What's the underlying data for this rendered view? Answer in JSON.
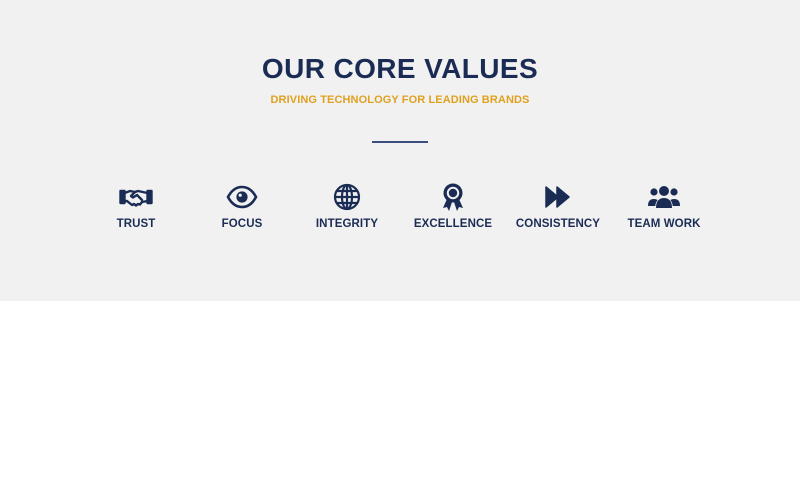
{
  "section": {
    "title": "OUR CORE VALUES",
    "subtitle": "DRIVING TECHNOLOGY FOR LEADING BRANDS"
  },
  "values": [
    {
      "label": "TRUST",
      "icon": "handshake-icon"
    },
    {
      "label": "FOCUS",
      "icon": "eye-icon"
    },
    {
      "label": "INTEGRITY",
      "icon": "globe-icon"
    },
    {
      "label": "EXCELLENCE",
      "icon": "award-ribbon-icon"
    },
    {
      "label": "CONSISTENCY",
      "icon": "fast-forward-icon"
    },
    {
      "label": "TEAM WORK",
      "icon": "users-group-icon"
    }
  ],
  "colors": {
    "background": "#f1f1f2",
    "title": "#1b2c54",
    "subtitle": "#e0a11f",
    "divider": "#3a4f7d"
  }
}
